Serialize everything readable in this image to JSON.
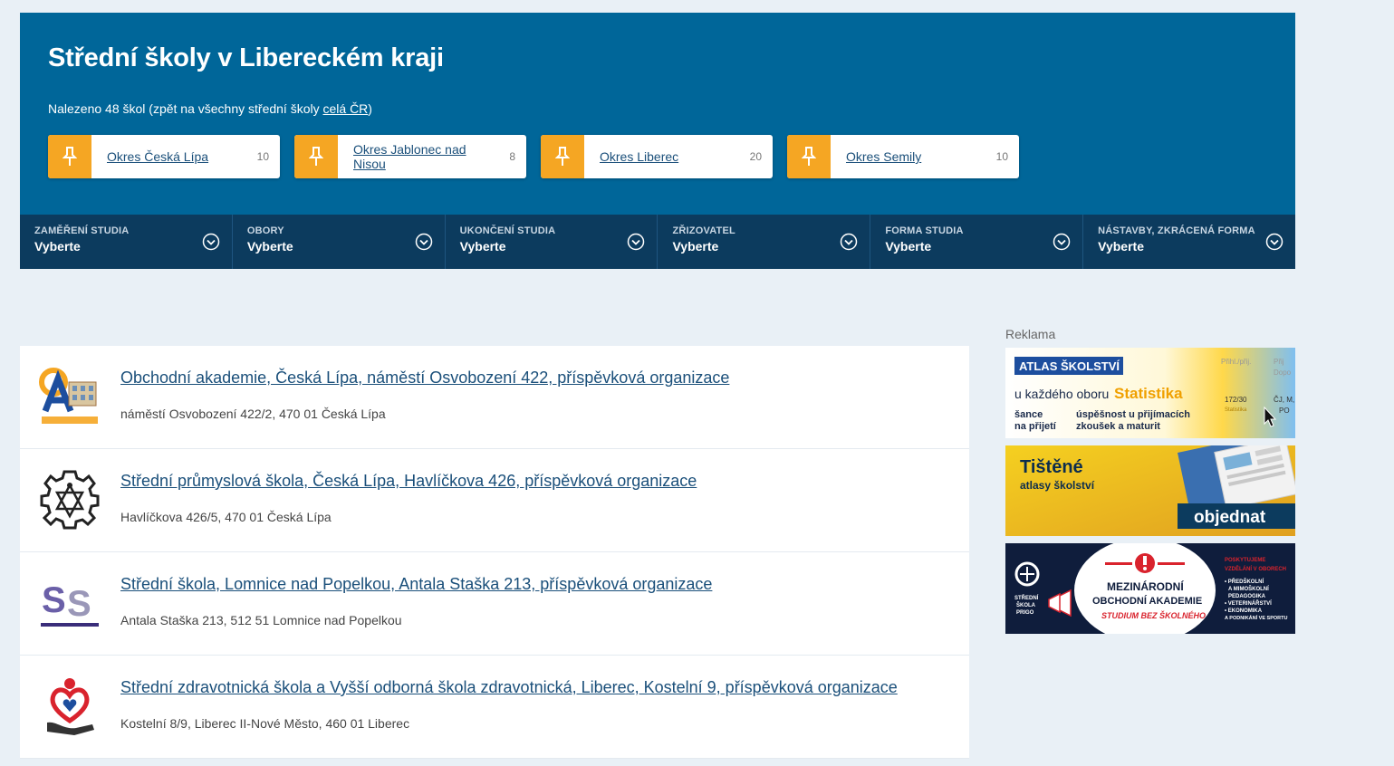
{
  "header": {
    "title": "Střední školy v Libereckém kraji",
    "found_prefix": "Nalezeno 48 škol (zpět na všechny střední školy ",
    "found_link": "celá ČR",
    "found_suffix": ")"
  },
  "districts": [
    {
      "name": "Okres Česká Lípa",
      "count": "10"
    },
    {
      "name": "Okres Jablonec nad Nisou",
      "count": "8"
    },
    {
      "name": "Okres Liberec",
      "count": "20"
    },
    {
      "name": "Okres Semily",
      "count": "10"
    }
  ],
  "filters": [
    {
      "label": "ZAMĚŘENÍ STUDIA",
      "value": "Vyberte"
    },
    {
      "label": "OBORY",
      "value": "Vyberte"
    },
    {
      "label": "UKONČENÍ STUDIA",
      "value": "Vyberte"
    },
    {
      "label": "ZŘIZOVATEL",
      "value": "Vyberte"
    },
    {
      "label": "FORMA STUDIA",
      "value": "Vyberte"
    },
    {
      "label": "NÁSTAVBY, ZKRÁCENÁ FORMA",
      "value": "Vyberte"
    }
  ],
  "schools": [
    {
      "name": "Obchodní akademie, Česká Lípa, náměstí Osvobození 422, příspěvková organizace",
      "address": "náměstí Osvobození 422/2, 470 01 Česká Lípa",
      "logo": "oa-ceska-lipa-logo"
    },
    {
      "name": "Střední průmyslová škola, Česká Lípa, Havlíčkova 426, příspěvková organizace",
      "address": "Havlíčkova 426/5, 470 01 Česká Lípa",
      "logo": "gear-compass-logo"
    },
    {
      "name": "Střední škola, Lomnice nad Popelkou, Antala Staška 213, příspěvková organizace",
      "address": "Antala Staška 213, 512 51 Lomnice nad Popelkou",
      "logo": "ss-lomnice-logo"
    },
    {
      "name": "Střední zdravotnická škola a Vyšší odborná škola zdravotnická, Liberec, Kostelní 9, příspěvková organizace",
      "address": "Kostelní 8/9, Liberec II-Nové Město, 460 01 Liberec",
      "logo": "heart-hand-logo"
    }
  ],
  "ads": {
    "label": "Reklama",
    "ad1": {
      "brand": "ATLAS ŠKOLSTVÍ",
      "line1": "u každého oboru",
      "highlight": "Statistika",
      "line2a": "šance",
      "line2b": "na přijetí",
      "line3a": "úspěšnost u přijímacích",
      "line3b": "zkoušek a maturit",
      "table_head": "Přihl./přij.",
      "table_val": "172/30",
      "table_small": "Statistika",
      "side1": "Přij",
      "side2": "Dopo",
      "side3": "ČJ, M,",
      "side4": "PO"
    },
    "ad2": {
      "title": "Tištěné",
      "subtitle": "atlasy školství",
      "button": "objednat"
    },
    "ad3": {
      "school_line1": "STŘEDNÍ",
      "school_line2": "ŠKOLA",
      "school_line3": "PRIGO",
      "title1": "MEZINÁRODNÍ",
      "title2": "OBCHODNÍ AKADEMIE",
      "subtitle": "STUDIUM BEZ ŠKOLNÉHO",
      "right1": "POSKYTUJEME",
      "right2": "VZDĚLÁNÍ V OBORECH",
      "right3": "• PŘEDŠKOLNÍ",
      "right4": "A MIMOŠKOLNÍ",
      "right5": "PEDAGOGIKA",
      "right6": "• VETERINÁŘSTVÍ",
      "right7": "• EKONOMIKA",
      "right8": "A PODNIKÁNÍ VE SPORTU"
    }
  },
  "colors": {
    "header_bg": "#006699",
    "filter_bg": "#0c3b5e",
    "accent": "#f5a623",
    "link": "#1a4f7a"
  }
}
